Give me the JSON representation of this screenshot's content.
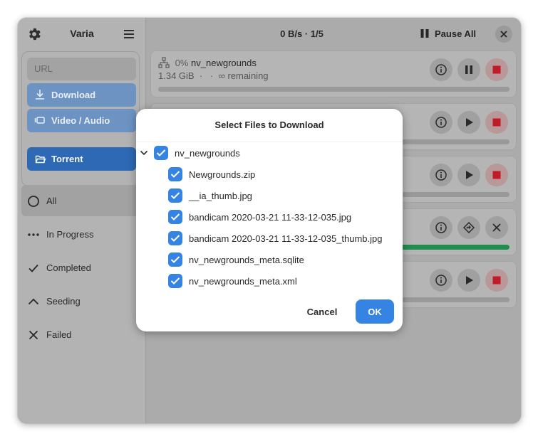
{
  "app": {
    "title": "Varia"
  },
  "sidebar": {
    "url_placeholder": "URL",
    "download_label": "Download",
    "video_audio_label": "Video / Audio",
    "torrent_label": "Torrent",
    "filters": [
      {
        "label": "All",
        "icon": "circle-icon",
        "active": true
      },
      {
        "label": "In Progress",
        "icon": "dots-icon",
        "active": false
      },
      {
        "label": "Completed",
        "icon": "check-icon",
        "active": false
      },
      {
        "label": "Seeding",
        "icon": "chevron-up-icon",
        "active": false
      },
      {
        "label": "Failed",
        "icon": "x-icon",
        "active": false
      }
    ]
  },
  "header": {
    "speed_status": "0 B/s  ·  1/5",
    "pause_all_label": "Pause All"
  },
  "downloads": [
    {
      "percent": "0%",
      "name": "nv_newgrounds",
      "size": "1.34 GiB",
      "remaining": "∞ remaining",
      "progress": 0.0,
      "state": "active"
    },
    {
      "progress": 0.0,
      "state": "paused"
    },
    {
      "progress": 0.0,
      "state": "paused"
    },
    {
      "progress": 1.0,
      "state": "completed"
    },
    {
      "progress": 0.0,
      "state": "paused"
    }
  ],
  "dialog": {
    "title": "Select Files to Download",
    "root": {
      "name": "nv_newgrounds",
      "checked": true
    },
    "files": [
      {
        "name": "Newgrounds.zip",
        "checked": true
      },
      {
        "name": "__ia_thumb.jpg",
        "checked": true
      },
      {
        "name": "bandicam 2020-03-21 11-33-12-035.jpg",
        "checked": true
      },
      {
        "name": "bandicam 2020-03-21 11-33-12-035_thumb.jpg",
        "checked": true
      },
      {
        "name": "nv_newgrounds_meta.sqlite",
        "checked": true
      },
      {
        "name": "nv_newgrounds_meta.xml",
        "checked": true
      }
    ],
    "cancel_label": "Cancel",
    "ok_label": "OK"
  },
  "colors": {
    "accent": "#3584e4",
    "torrent_button": "#2d69b5",
    "progress_complete": "#1f8d4e",
    "stop_icon": "#c01c28"
  }
}
